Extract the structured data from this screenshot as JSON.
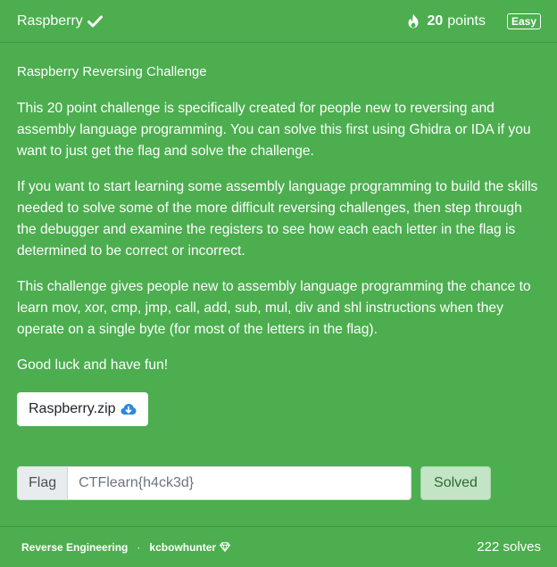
{
  "header": {
    "title": "Raspberry",
    "points_value": "20",
    "points_label": "points",
    "difficulty": "Easy",
    "icons": [
      "check-icon",
      "flame-icon"
    ]
  },
  "body": {
    "subtitle": "Raspberry Reversing Challenge",
    "paragraphs": [
      "This 20 point challenge is specifically created for people new to reversing and assembly language programming. You can solve this first using Ghidra or IDA if you want to just get the flag and solve the challenge.",
      "If you want to start learning some assembly language programming to build the skills needed to solve some of the more difficult reversing challenges, then step through the debugger and examine the registers to see how each each letter in the flag is determined to be correct or incorrect.",
      "This challenge gives people new to assembly language programming the chance to learn mov, xor, cmp, jmp, call, add, sub, mul, div and shl instructions when they operate on a single byte (for most of the letters in the flag).",
      "Good luck and have fun!"
    ],
    "download": {
      "label": "Raspberry.zip",
      "icon": "cloud-download-icon"
    }
  },
  "flag": {
    "label": "Flag",
    "value": "CTFlearn{h4ck3d}",
    "submit_label": "Solved"
  },
  "footer": {
    "category": "Reverse Engineering",
    "separator": "·",
    "author": "kcbowhunter",
    "author_icon": "diamond-icon",
    "solves": "222 solves"
  },
  "colors": {
    "background": "#4cae4f",
    "badge_border": "#ffffff",
    "solved_button": "#c3e4c5"
  }
}
